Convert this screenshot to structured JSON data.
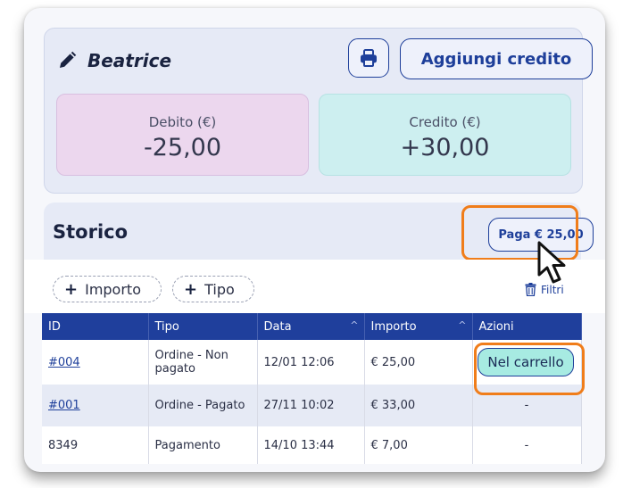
{
  "customer": {
    "name": "Beatrice"
  },
  "actions": {
    "add_credit_label": "Aggiungi credito",
    "print_icon": "printer-icon",
    "edit_icon": "pencil-icon"
  },
  "balance": {
    "debt_label": "Debito (€)",
    "debt_value": "-25,00",
    "credit_label": "Credito (€)",
    "credit_value": "+30,00"
  },
  "history": {
    "title": "Storico",
    "pay_label": "Paga € 25,00",
    "chips": [
      "Importo",
      "Tipo"
    ],
    "filter_label": "Filtri",
    "columns": [
      "ID",
      "Tipo",
      "Data",
      "Importo",
      "Azioni"
    ],
    "rows": [
      {
        "id": "#004",
        "tipo": "Ordine - Non pagato",
        "data": "12/01 12:06",
        "importo": "€ 25,00",
        "azione": "Nel carrello"
      },
      {
        "id": "#001",
        "tipo": "Ordine - Pagato",
        "data": "27/11 10:02",
        "importo": "€ 33,00",
        "azione": "-"
      },
      {
        "id": "8349",
        "tipo": "Pagamento",
        "data": "14/10 13:44",
        "importo": "€ 7,00",
        "azione": "-"
      }
    ]
  },
  "colors": {
    "primary": "#1f3f9c",
    "highlight": "#f07d1a",
    "debt_bg": "#ecd7ee",
    "credit_bg": "#cdeff0",
    "cart_badge": "#a7ebe2"
  }
}
